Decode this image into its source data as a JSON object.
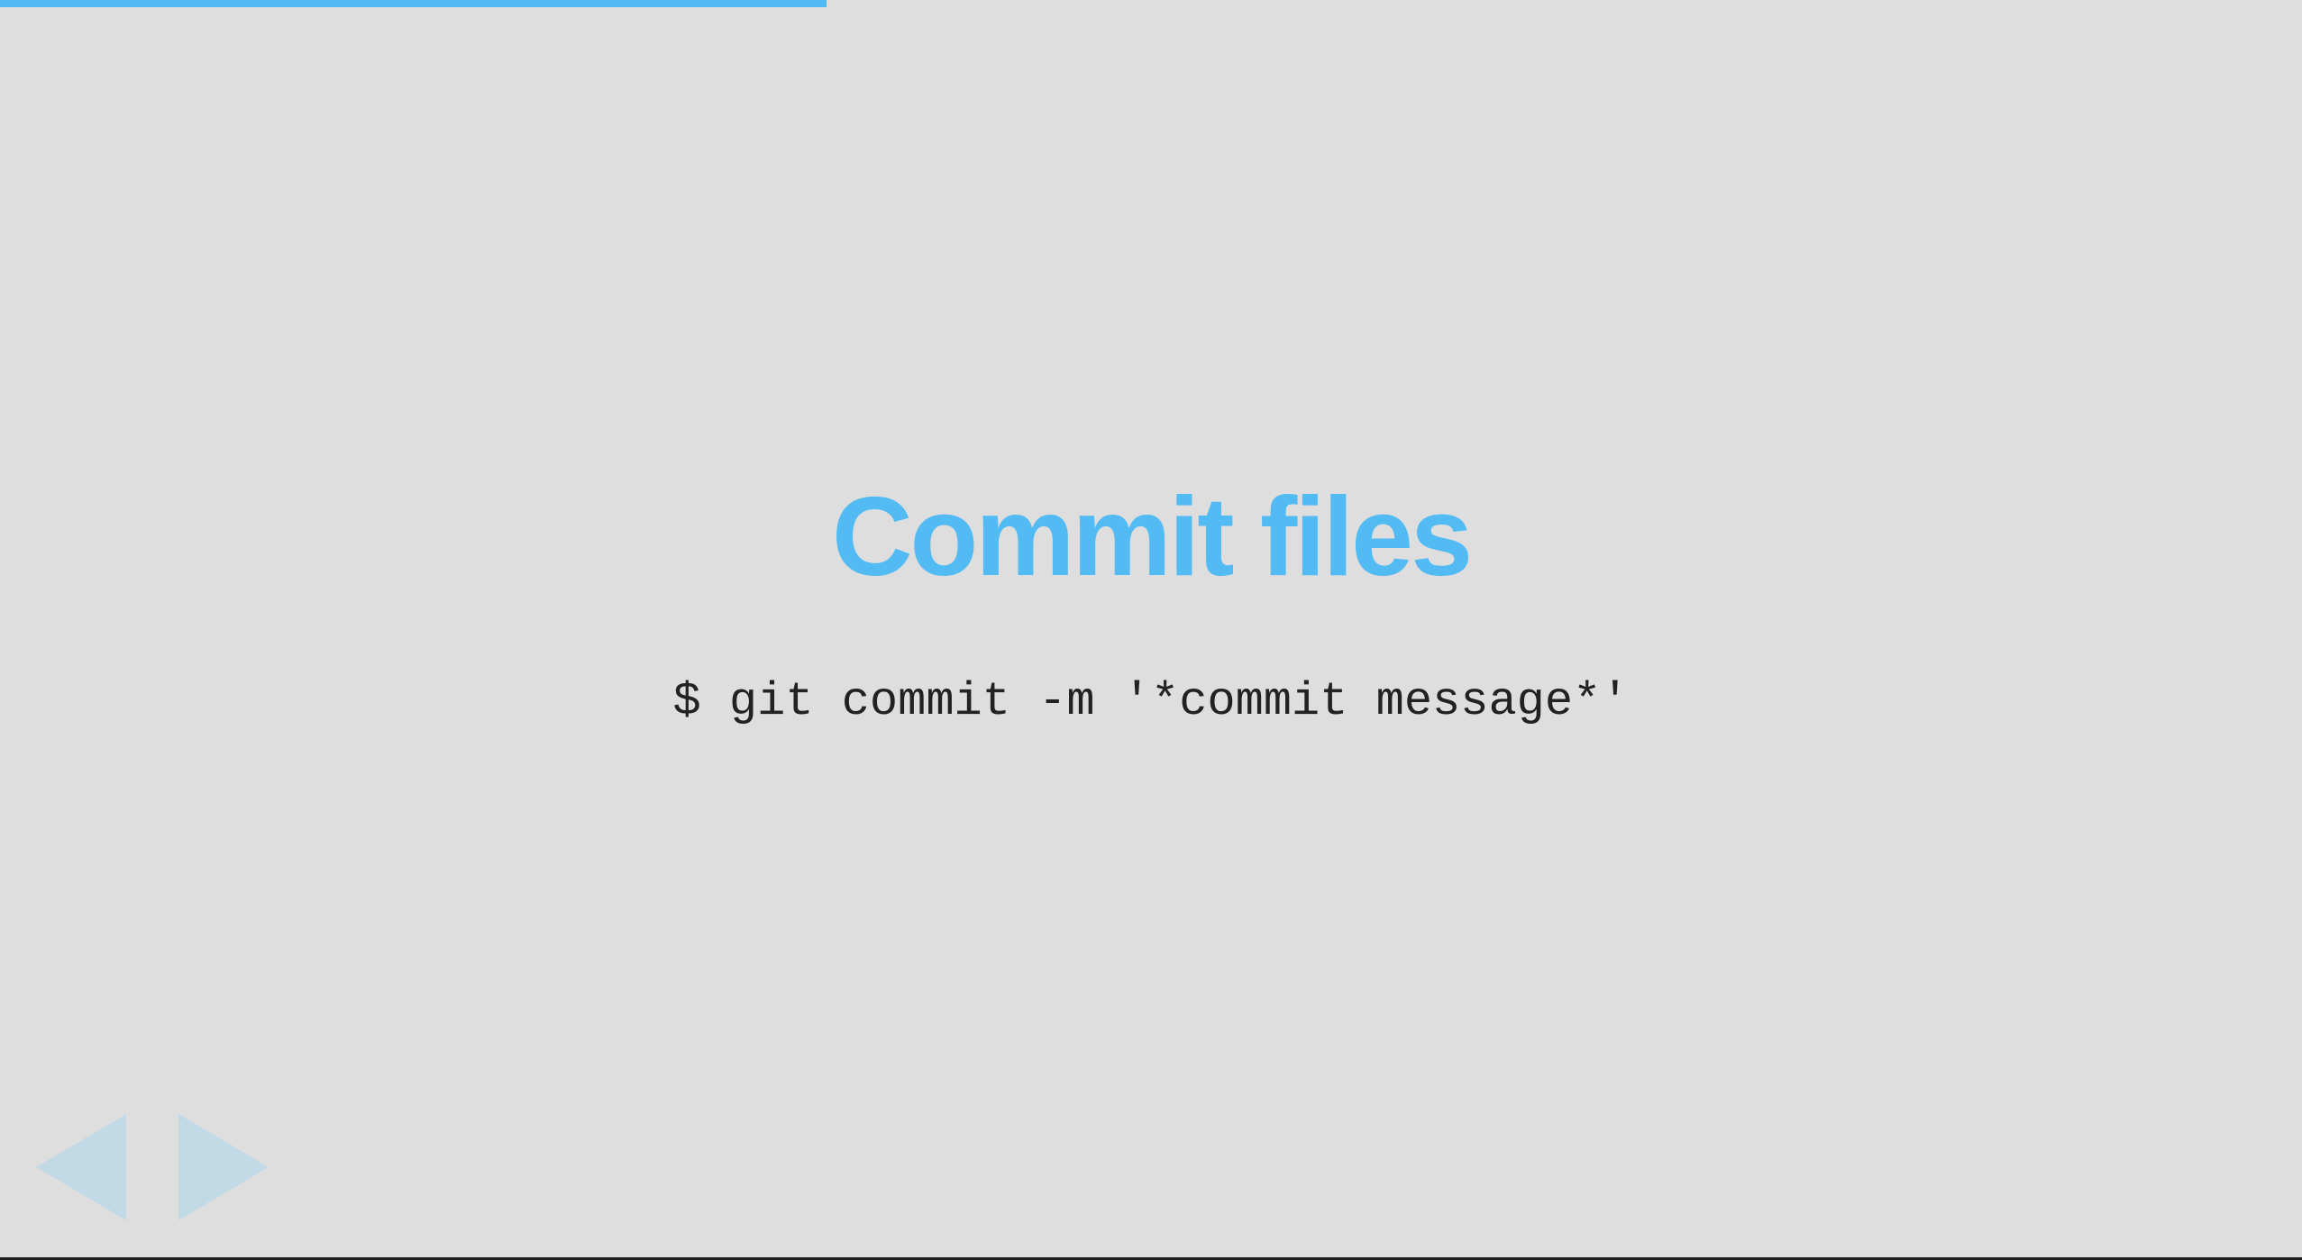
{
  "slide": {
    "title": "Commit files",
    "command": "$ git commit -m '*commit message*'"
  },
  "progress": {
    "fraction": 0.359,
    "color": "#52bbf3"
  },
  "navigation": {
    "prev_icon": "triangle-left",
    "next_icon": "triangle-right",
    "arrow_color": "#c2d9e6"
  },
  "colors": {
    "background": "#dedede",
    "accent": "#52bbf3",
    "code_text": "#222222"
  }
}
